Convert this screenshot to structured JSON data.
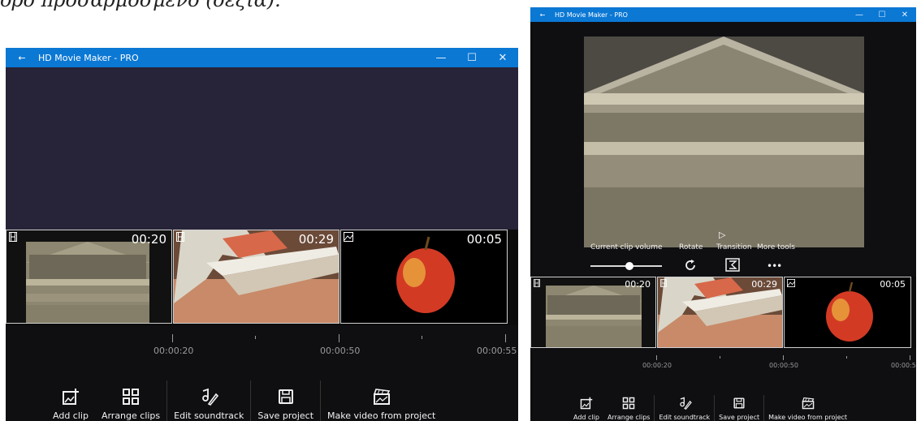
{
  "caption": "ορο προσαρμοσμενο (δεξιά).",
  "left_window": {
    "title": "HD Movie Maker - PRO",
    "back_icon": "←",
    "minimize_icon": "—",
    "maximize_icon": "☐",
    "close_icon": "✕",
    "clips": [
      {
        "duration": "00:20",
        "type_icon": "film-icon",
        "subject": "temple-frieze"
      },
      {
        "duration": "00:29",
        "type_icon": "film-icon",
        "subject": "building-3d"
      },
      {
        "duration": "00:05",
        "type_icon": "image-icon",
        "subject": "apple"
      }
    ],
    "timeline_labels": [
      "00:00:20",
      "00:00:50",
      "00:00:55"
    ],
    "toolbar": {
      "add_clip": "Add clip",
      "arrange_clips": "Arrange clips",
      "edit_soundtrack": "Edit soundtrack",
      "save_project": "Save project",
      "make_video": "Make video from project"
    }
  },
  "right_window": {
    "title": "HD Movie Maker - PRO",
    "back_icon": "←",
    "minimize_icon": "—",
    "maximize_icon": "☐",
    "close_icon": "✕",
    "play_icon": "▷",
    "edit_controls": {
      "clip_volume_label": "Current clip volume",
      "clip_volume": 0.55,
      "rotate_label": "Rotate",
      "transition_label": "Transition",
      "more_tools_label": "More tools",
      "more_icon": "•••"
    },
    "clips": [
      {
        "duration": "00:20",
        "type_icon": "film-icon",
        "subject": "temple-frieze"
      },
      {
        "duration": "00:29",
        "type_icon": "film-icon",
        "subject": "building-3d"
      },
      {
        "duration": "00:05",
        "type_icon": "image-icon",
        "subject": "apple"
      }
    ],
    "timeline_labels": [
      "00:00:20",
      "00:00:50",
      "00:00:5"
    ],
    "toolbar": {
      "add_clip": "Add clip",
      "arrange_clips": "Arrange clips",
      "edit_soundtrack": "Edit soundtrack",
      "save_project": "Save project",
      "make_video": "Make video from project"
    }
  },
  "colors": {
    "titlebar": "#0b78d4",
    "preview_empty": "#272338",
    "window_bg": "#0f0f12",
    "text_muted": "#9a9a9a"
  }
}
